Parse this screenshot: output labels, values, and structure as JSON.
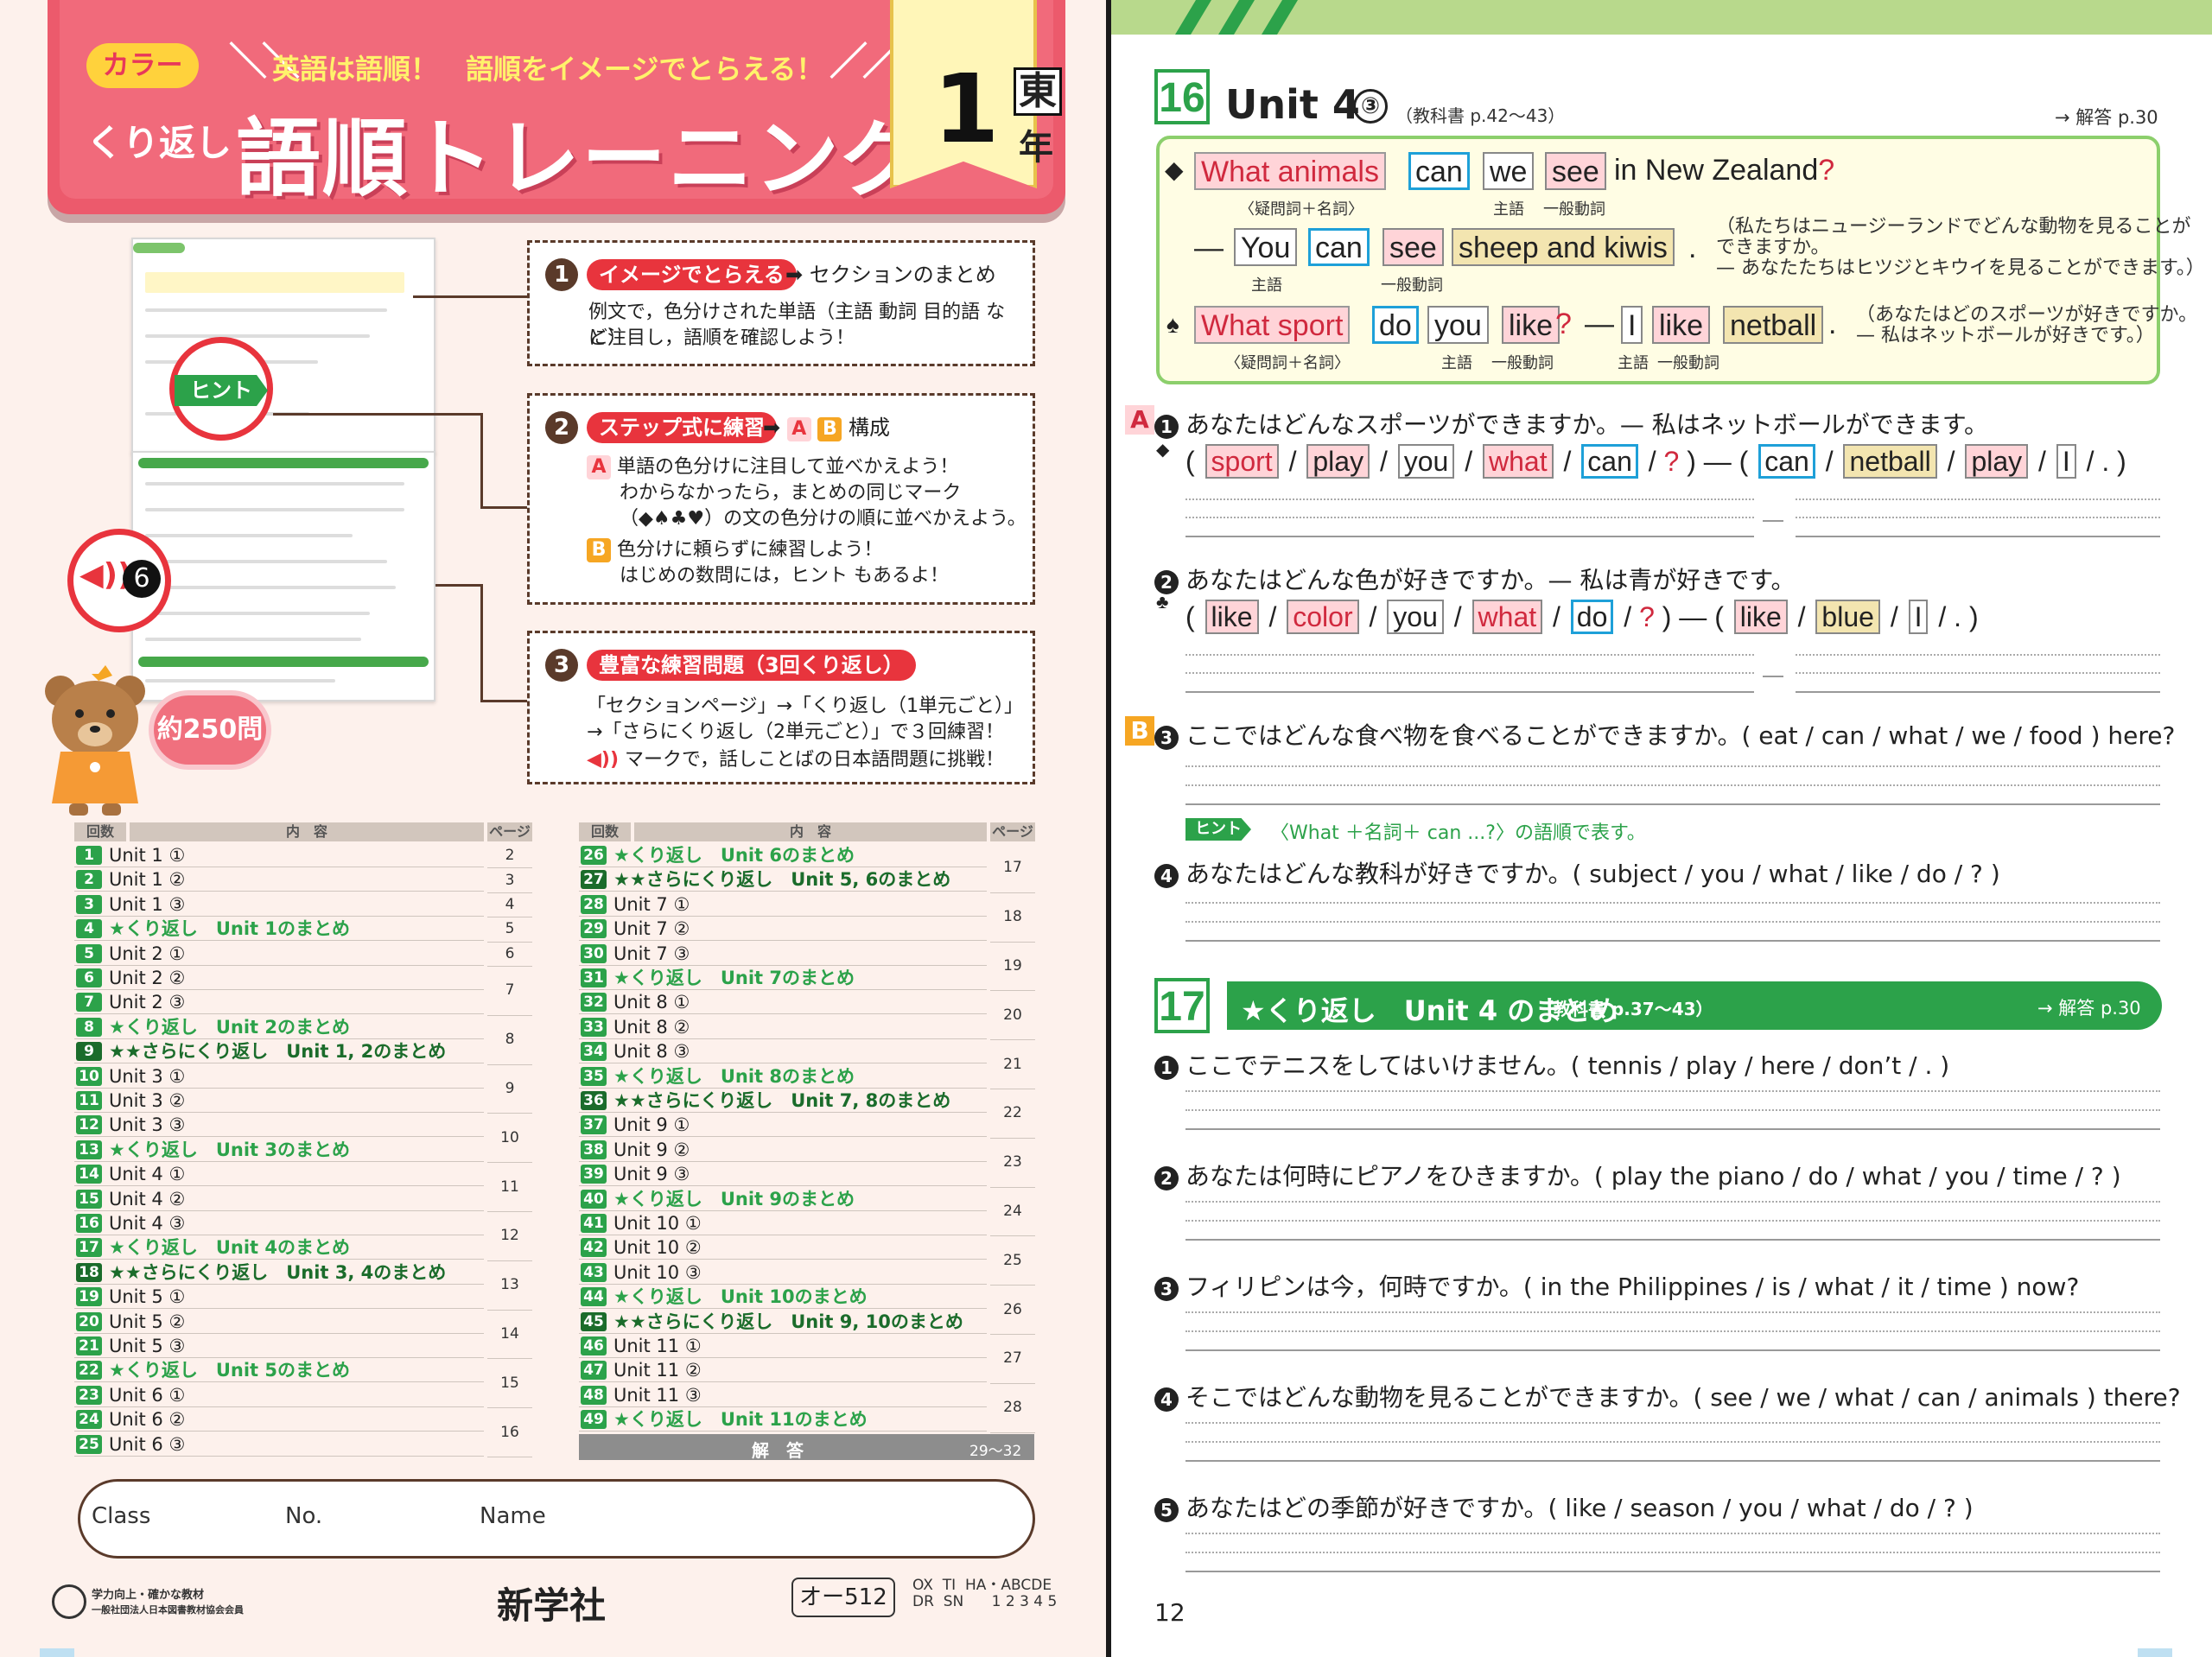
{
  "cover": {
    "badge": "カラー",
    "tagline": "英語は語順！　語順をイメージでとらえる！",
    "subtitle_prefix": "くり返し",
    "title": "語順トレーニング",
    "grade_num": "1",
    "grade_publisher": "東",
    "grade_year": "年"
  },
  "features": {
    "f1": {
      "num": "1",
      "label": "イメージでとらえる",
      "arrow": "セクションのまとめ",
      "line1": "例文で，色分けされた単語（主語 動詞 目的語 など）",
      "line2": "に注目し，語順を確認しよう！"
    },
    "f2": {
      "num": "2",
      "label": "ステップ式に練習",
      "arrow_a": "A",
      "arrow_b": "B",
      "arrow_suffix": "構成",
      "a_label": "A",
      "a_l1": "単語の色分けに注目して並べかえよう！",
      "a_l2": "わからなかったら，まとめの同じマーク",
      "a_l3": "（◆♠♣♥）の文の色分けの順に並べかえよう。",
      "b_label": "B",
      "b_l1": "色分けに頼らずに練習しよう！",
      "b_l2": "はじめの数問には，ヒント もあるよ！"
    },
    "f3": {
      "num": "3",
      "label": "豊富な練習問題（3回くり返し）",
      "l1": "「セクションページ」→「くり返し（1単元ごと）」",
      "l2": "→「さらにくり返し（2単元ごと）」で３回練習！",
      "l3": "マークで，話しことばの日本語問題に挑戦！"
    }
  },
  "hint_tag": "ヒント",
  "voice_num": "6",
  "count_bubble": "約250問",
  "toc": {
    "headers": {
      "num": "回数",
      "content": "内　容",
      "page": "ページ"
    },
    "left": [
      {
        "n": "1",
        "t": "Unit 1 ①",
        "k": "n"
      },
      {
        "n": "2",
        "t": "Unit 1 ②",
        "k": "n"
      },
      {
        "n": "3",
        "t": "Unit 1 ③",
        "k": "n"
      },
      {
        "n": "4",
        "t": "★くり返し　Unit 1のまとめ",
        "k": "r"
      },
      {
        "n": "5",
        "t": "Unit 2 ①",
        "k": "n"
      },
      {
        "n": "6",
        "t": "Unit 2 ②",
        "k": "n"
      },
      {
        "n": "7",
        "t": "Unit 2 ③",
        "k": "n"
      },
      {
        "n": "8",
        "t": "★くり返し　Unit 2のまとめ",
        "k": "r"
      },
      {
        "n": "9",
        "t": "★★さらにくり返し　Unit 1, 2のまとめ",
        "k": "r2"
      },
      {
        "n": "10",
        "t": "Unit 3 ①",
        "k": "n"
      },
      {
        "n": "11",
        "t": "Unit 3 ②",
        "k": "n"
      },
      {
        "n": "12",
        "t": "Unit 3 ③",
        "k": "n"
      },
      {
        "n": "13",
        "t": "★くり返し　Unit 3のまとめ",
        "k": "r"
      },
      {
        "n": "14",
        "t": "Unit 4 ①",
        "k": "n"
      },
      {
        "n": "15",
        "t": "Unit 4 ②",
        "k": "n"
      },
      {
        "n": "16",
        "t": "Unit 4 ③",
        "k": "n"
      },
      {
        "n": "17",
        "t": "★くり返し　Unit 4のまとめ",
        "k": "r"
      },
      {
        "n": "18",
        "t": "★★さらにくり返し　Unit 3, 4のまとめ",
        "k": "r2"
      },
      {
        "n": "19",
        "t": "Unit 5 ①",
        "k": "n"
      },
      {
        "n": "20",
        "t": "Unit 5 ②",
        "k": "n"
      },
      {
        "n": "21",
        "t": "Unit 5 ③",
        "k": "n"
      },
      {
        "n": "22",
        "t": "★くり返し　Unit 5のまとめ",
        "k": "r"
      },
      {
        "n": "23",
        "t": "Unit 6 ①",
        "k": "n"
      },
      {
        "n": "24",
        "t": "Unit 6 ②",
        "k": "n"
      },
      {
        "n": "25",
        "t": "Unit 6 ③",
        "k": "n"
      }
    ],
    "left_pages": [
      "2",
      "3",
      "4",
      "5",
      "6",
      "7",
      "8",
      "9",
      "10",
      "11",
      "12",
      "13",
      "14",
      "15",
      "16"
    ],
    "right": [
      {
        "n": "26",
        "t": "★くり返し　Unit 6のまとめ",
        "k": "r"
      },
      {
        "n": "27",
        "t": "★★さらにくり返し　Unit 5, 6のまとめ",
        "k": "r2"
      },
      {
        "n": "28",
        "t": "Unit 7 ①",
        "k": "n"
      },
      {
        "n": "29",
        "t": "Unit 7 ②",
        "k": "n"
      },
      {
        "n": "30",
        "t": "Unit 7 ③",
        "k": "n"
      },
      {
        "n": "31",
        "t": "★くり返し　Unit 7のまとめ",
        "k": "r"
      },
      {
        "n": "32",
        "t": "Unit 8 ①",
        "k": "n"
      },
      {
        "n": "33",
        "t": "Unit 8 ②",
        "k": "n"
      },
      {
        "n": "34",
        "t": "Unit 8 ③",
        "k": "n"
      },
      {
        "n": "35",
        "t": "★くり返し　Unit 8のまとめ",
        "k": "r"
      },
      {
        "n": "36",
        "t": "★★さらにくり返し　Unit 7, 8のまとめ",
        "k": "r2"
      },
      {
        "n": "37",
        "t": "Unit 9 ①",
        "k": "n"
      },
      {
        "n": "38",
        "t": "Unit 9 ②",
        "k": "n"
      },
      {
        "n": "39",
        "t": "Unit 9 ③",
        "k": "n"
      },
      {
        "n": "40",
        "t": "★くり返し　Unit 9のまとめ",
        "k": "r"
      },
      {
        "n": "41",
        "t": "Unit 10 ①",
        "k": "n"
      },
      {
        "n": "42",
        "t": "Unit 10 ②",
        "k": "n"
      },
      {
        "n": "43",
        "t": "Unit 10 ③",
        "k": "n"
      },
      {
        "n": "44",
        "t": "★くり返し　Unit 10のまとめ",
        "k": "r"
      },
      {
        "n": "45",
        "t": "★★さらにくり返し　Unit 9, 10のまとめ",
        "k": "r2"
      },
      {
        "n": "46",
        "t": "Unit 11 ①",
        "k": "n"
      },
      {
        "n": "47",
        "t": "Unit 11 ②",
        "k": "n"
      },
      {
        "n": "48",
        "t": "Unit 11 ③",
        "k": "n"
      },
      {
        "n": "49",
        "t": "★くり返し　Unit 11のまとめ",
        "k": "r"
      }
    ],
    "right_pages": [
      "17",
      "18",
      "19",
      "20",
      "21",
      "22",
      "23",
      "24",
      "25",
      "26",
      "27",
      "28"
    ],
    "answers_label": "解　答",
    "answers_pages": "29〜32"
  },
  "name_box": {
    "class": "Class",
    "no": "No.",
    "name": "Name"
  },
  "footer": {
    "org1": "学力向上・確かな教材",
    "org2": "一般社団法人日本図書教材協会会員",
    "publisher": "新学社",
    "code": "オー512",
    "codes": "OX  TI  HA・ABCDE\nDR  SN      1 2 3 4 5"
  },
  "unit16": {
    "num": "16",
    "title": "Unit 4",
    "circ": "③",
    "ref": "（教科書 p.42〜43）",
    "answer_ref": "→ 解答 p.30",
    "ex1": {
      "w1": "What animals",
      "w2": "can",
      "w3": "we",
      "w4": "see",
      "rest": "in New Zealand",
      "q": "?",
      "sub1": "〈疑問詞＋名詞〉",
      "sub2": "主語",
      "sub3": "一般動詞"
    },
    "ex1ans": {
      "dash": "—",
      "w1": "You",
      "w2": "can",
      "w3": "see",
      "w4": "sheep and kiwis",
      "p": ".",
      "sub1": "主語",
      "sub2": "一般動詞",
      "jp1": "（私たちはニュージーランドでどんな動物を見ることが",
      "jp2": "できますか。",
      "jp3": "— あなたたちはヒツジとキウイを見ることができます。）"
    },
    "ex2": {
      "w1": "What sport",
      "w2": "do",
      "w3": "you",
      "w4": "like",
      "q": "?",
      "dash": "—",
      "w5": "I",
      "w6": "like",
      "w7": "netball",
      "p": ".",
      "sub1": "〈疑問詞＋名詞〉",
      "sub2": "主語",
      "sub3": "一般動詞",
      "sub4": "主語",
      "sub5": "一般動詞",
      "jp1": "（あなたはどのスポーツが好きですか。",
      "jp2": "— 私はネットボールが好きです。）"
    },
    "qA": "A",
    "q1": {
      "num": "1",
      "text": "あなたはどんなスポーツができますか。— 私はネットボールができます。",
      "opts": [
        "sport",
        "play",
        "you",
        "what",
        "can",
        "?"
      ],
      "opts2": [
        "can",
        "netball",
        "play",
        "I",
        "."
      ]
    },
    "q2": {
      "num": "2",
      "text": "あなたはどんな色が好きですか。— 私は青が好きです。",
      "opts": [
        "like",
        "color",
        "you",
        "what",
        "do",
        "?"
      ],
      "opts2": [
        "like",
        "blue",
        "I",
        "."
      ]
    },
    "qB": "B",
    "q3": {
      "num": "3",
      "text": "ここではどんな食べ物を食べることができますか。( eat / can / what / we / food ) here?"
    },
    "hint": "〈What ＋名詞＋ can ...?〉の語順で表す。",
    "q4": {
      "num": "4",
      "text": "あなたはどんな教科が好きですか。( subject / you / what / like / do / ? )"
    }
  },
  "unit17": {
    "num": "17",
    "title": "★くり返し　Unit 4 のまとめ",
    "ref": "（教科書 p.37〜43）",
    "answer_ref": "→ 解答 p.30",
    "q1": {
      "num": "1",
      "text": "ここでテニスをしてはいけません。( tennis / play / here / don’t / . )"
    },
    "q2": {
      "num": "2",
      "text": "あなたは何時にピアノをひきますか。( play the piano / do / what / you / time / ? )"
    },
    "q3": {
      "num": "3",
      "text": "フィリピンは今，何時ですか。( in the Philippines / is / what / it / time ) now?"
    },
    "q4": {
      "num": "4",
      "text": "そこではどんな動物を見ることができますか。( see / we / what / can / animals ) there?"
    },
    "q5": {
      "num": "5",
      "text": "あなたはどの季節が好きですか。( like / season / you / what / do / ? )"
    }
  },
  "page_number": "12",
  "colors": {
    "pink": "#f16a7b",
    "green": "#2ca24a",
    "question": "#ffd4d8",
    "verb_border": "#1ea0d8",
    "object": "#f3e5b0"
  }
}
